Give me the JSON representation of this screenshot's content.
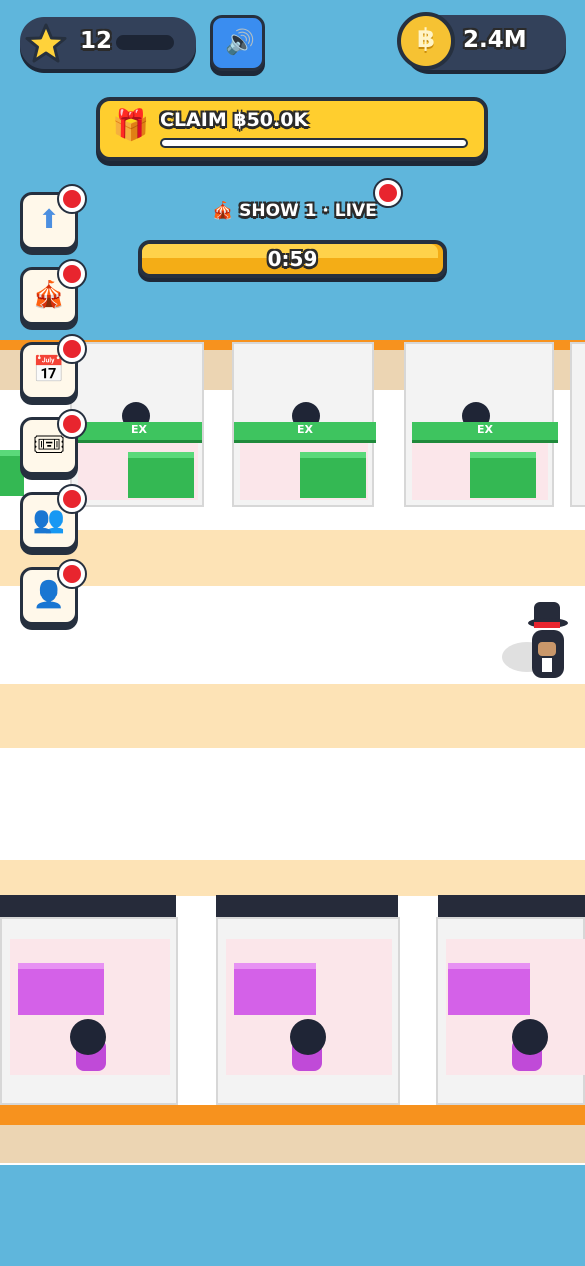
{
  "hud": {
    "stars": "12",
    "coins": "2.4M",
    "coin_symbol": "฿",
    "sound_icon": "speaker-icon"
  },
  "claim": {
    "label": "CLAIM ฿50.0K",
    "icon": "gift-icon"
  },
  "show": {
    "label": "SHOW 1 · LIVE",
    "timer": "0:59",
    "icon": "circus-tent-icon"
  },
  "side_buttons": [
    {
      "name": "upgrade",
      "icon": "up-arrow-icon",
      "glyph": "⬆"
    },
    {
      "name": "shows",
      "icon": "circus-tent-icon",
      "glyph": "🎪"
    },
    {
      "name": "calendar",
      "icon": "calendar-icon",
      "glyph": "📅"
    },
    {
      "name": "tickets",
      "icon": "ticket-icon",
      "glyph": "🎟"
    },
    {
      "name": "staff",
      "icon": "people-icon",
      "glyph": "👥"
    },
    {
      "name": "profile",
      "icon": "person-icon",
      "glyph": "👤"
    }
  ],
  "booths": {
    "top_sign": "EX"
  },
  "colors": {
    "sky": "#5fb6dc",
    "accent_orange": "#f7921e",
    "gold": "#ffce2e",
    "notification_red": "#e8252e"
  }
}
